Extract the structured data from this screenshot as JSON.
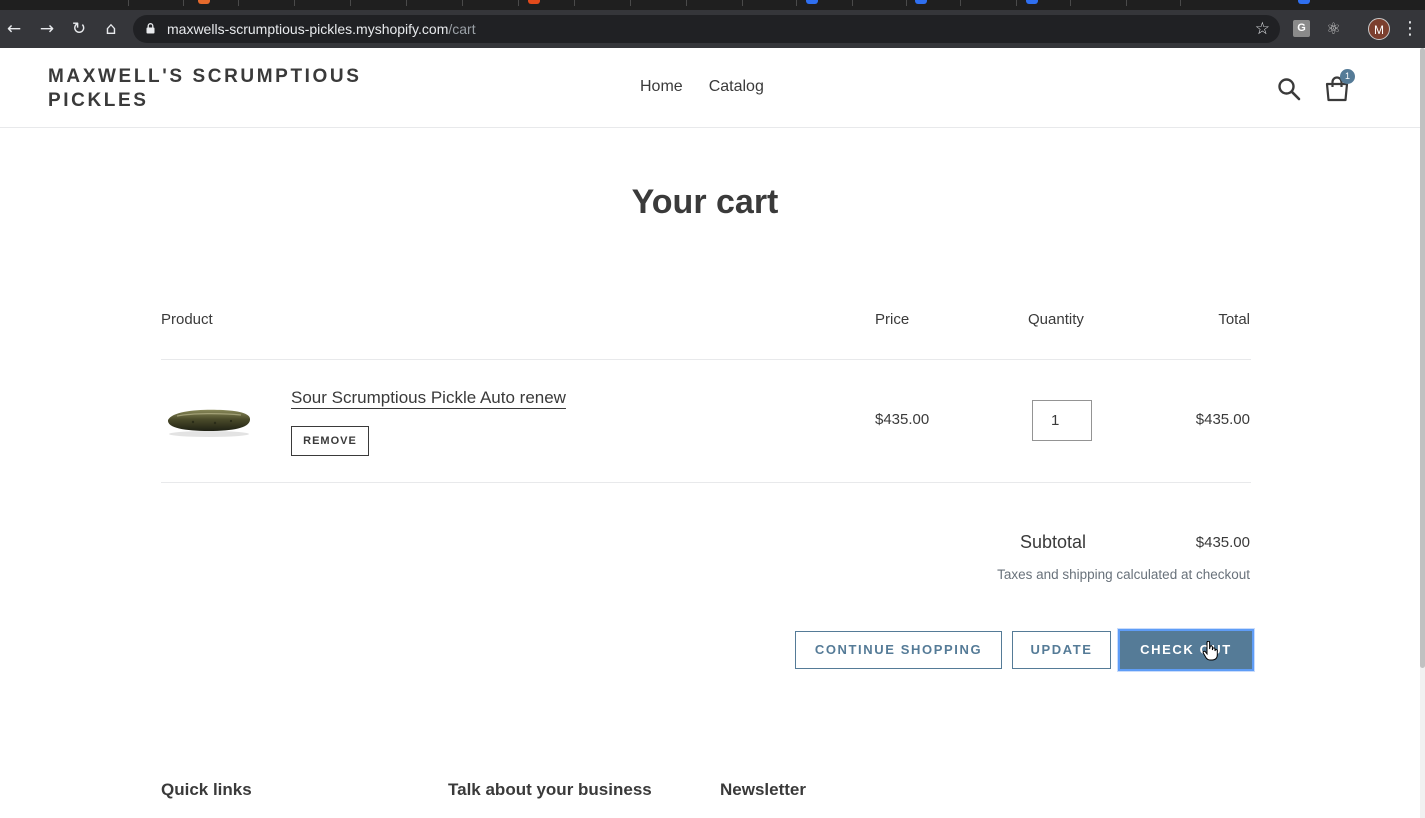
{
  "browser": {
    "url_host": "maxwells-scrumptious-pickles.myshopify.com",
    "url_path": "/cart",
    "profile_initial": "M",
    "extension_g_label": "G"
  },
  "store": {
    "name": "MAXWELL'S SCRUMPTIOUS PICKLES",
    "nav": [
      "Home",
      "Catalog"
    ],
    "cart_count": "1"
  },
  "cart": {
    "title": "Your cart",
    "headers": {
      "product": "Product",
      "price": "Price",
      "quantity": "Quantity",
      "total": "Total"
    },
    "items": [
      {
        "title": "Sour Scrumptious Pickle Auto renew",
        "remove_label": "REMOVE",
        "price": "$435.00",
        "quantity": "1",
        "total": "$435.00"
      }
    ],
    "subtotal_label": "Subtotal",
    "subtotal_value": "$435.00",
    "tax_note": "Taxes and shipping calculated at checkout",
    "buttons": {
      "continue": "CONTINUE SHOPPING",
      "update": "UPDATE",
      "checkout": "CHECK OUT"
    }
  },
  "footer": {
    "quick_links": "Quick links",
    "talk": "Talk about your business",
    "newsletter": "Newsletter"
  },
  "colors": {
    "accent": "#557b97",
    "text": "#3a3a3a",
    "focus_ring": "#5f9df7"
  }
}
